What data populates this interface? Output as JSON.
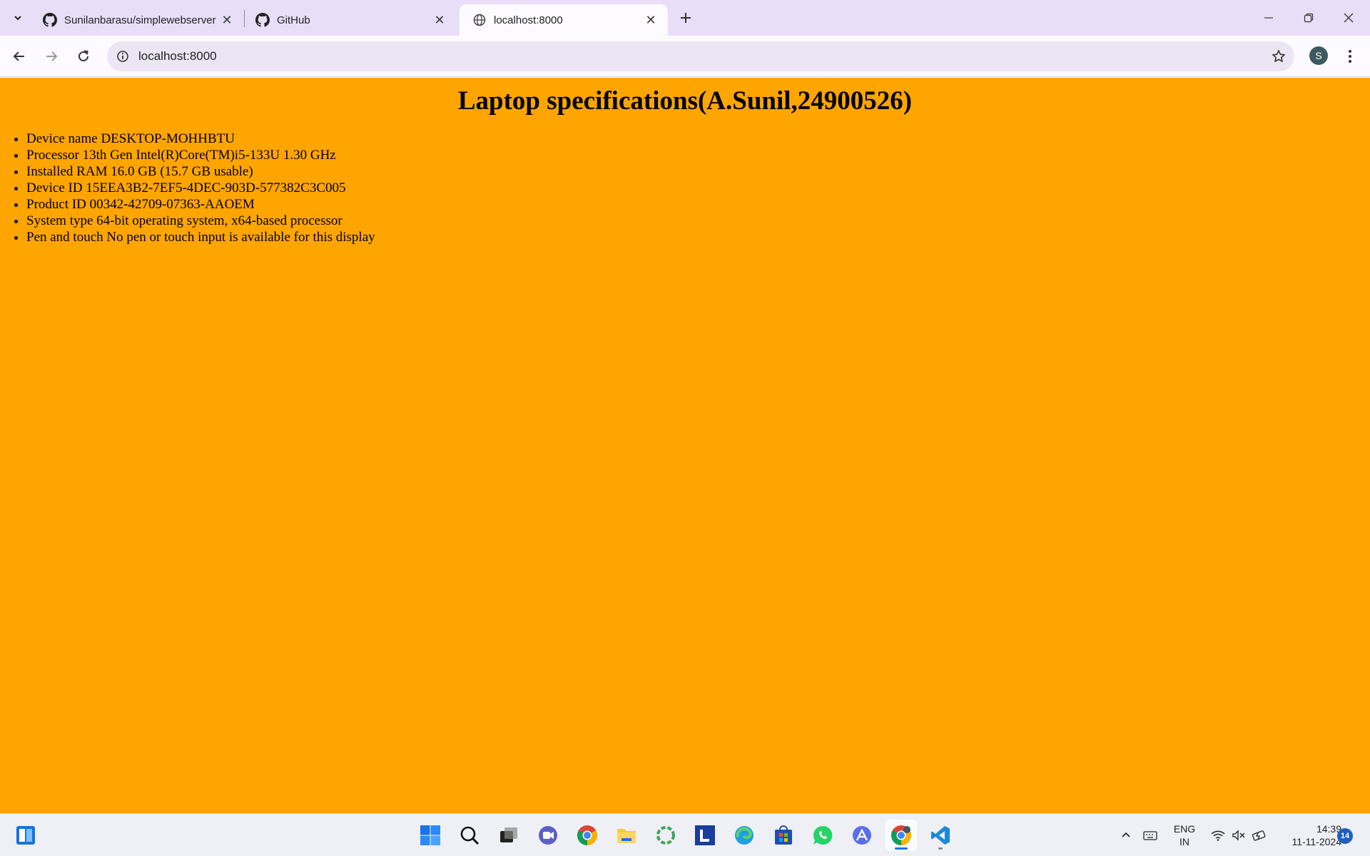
{
  "browser": {
    "tabs": [
      {
        "title": "Sunilanbarasu/simplewebserver",
        "favicon": "github-icon",
        "active": false
      },
      {
        "title": "GitHub",
        "favicon": "github-icon",
        "active": false
      },
      {
        "title": "localhost:8000",
        "favicon": "globe-icon",
        "active": true
      }
    ],
    "address_bar": {
      "url": "localhost:8000"
    },
    "profile_initial": "S"
  },
  "page": {
    "heading": "Laptop specifications(A.Sunil,24900526)",
    "background_color": "#ffa500",
    "specs": [
      "Device name DESKTOP-MOHHBTU",
      "Processor 13th Gen Intel(R)Core(TM)i5-133U 1.30 GHz",
      "Installed RAM 16.0 GB (15.7 GB usable)",
      "Device ID 15EEA3B2-7EF5-4DEC-903D-577382C3C005",
      "Product ID 00342-42709-07363-AAOEM",
      "System type 64-bit operating system, x64-based processor",
      "Pen and touch No pen or touch input is available for this display"
    ]
  },
  "taskbar": {
    "apps": [
      "widgets-icon",
      "windows-start-icon",
      "search-icon",
      "task-view-icon",
      "meet-icon",
      "chrome-icon",
      "file-explorer-icon",
      "green-ring-app-icon",
      "l-app-icon",
      "edge-icon",
      "store-icon",
      "whatsapp-icon",
      "vpn-app-icon",
      "chrome-profile-icon",
      "vscode-icon"
    ],
    "language": {
      "line1": "ENG",
      "line2": "IN"
    },
    "clock": {
      "time": "14:39",
      "date": "11-11-2024"
    },
    "notification_count": "14"
  }
}
